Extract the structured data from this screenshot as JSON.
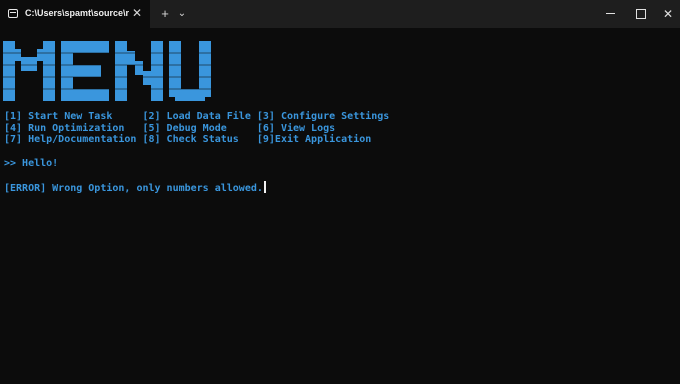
{
  "window": {
    "tab_title": "C:\\Users\\spamt\\source\\repos\\",
    "tab_close_icon": "close-icon",
    "new_tab_icon": "plus-icon",
    "dropdown_icon": "chevron-down-icon",
    "minimize_icon": "minimize-icon",
    "maximize_icon": "maximize-icon",
    "close_icon": "close-icon"
  },
  "terminal": {
    "banner_text": "MENU",
    "banner_color": "#3a96dd",
    "text_color": "#3a96dd",
    "menu_lines": [
      "[1] Start New Task     [2] Load Data File [3] Configure Settings",
      "[4] Run Optimization   [5] Debug Mode     [6] View Logs",
      "[7] Help/Documentation [8] Check Status   [9]Exit Application"
    ],
    "greeting": ">> Hello!",
    "error_message": "[ERROR] Wrong Option, only numbers allowed."
  }
}
